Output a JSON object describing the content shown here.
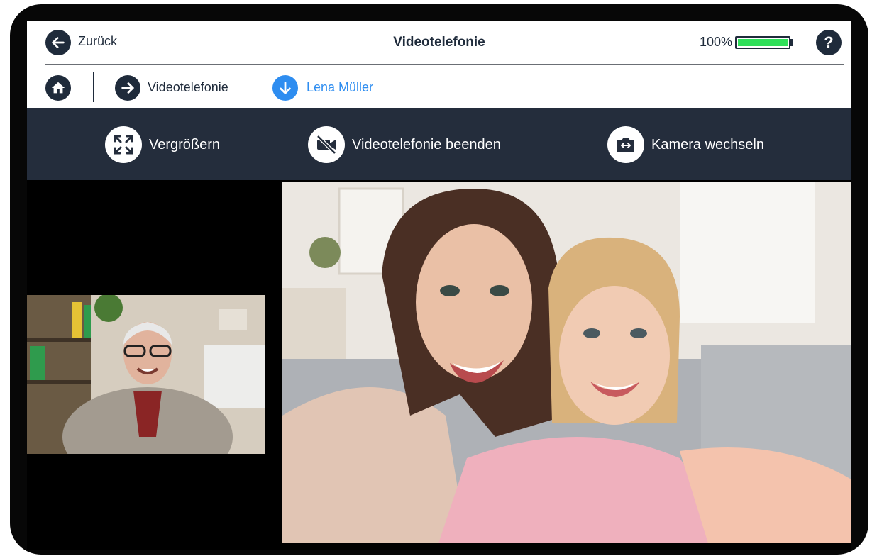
{
  "header": {
    "back_label": "Zurück",
    "title": "Videotelefonie",
    "battery_text": "100%",
    "battery_level": 1.0,
    "help_label": "?"
  },
  "breadcrumb": {
    "items": [
      {
        "label": "Videotelefonie",
        "icon": "arrow-right-icon"
      },
      {
        "label": "Lena Müller",
        "icon": "arrow-down-icon"
      }
    ]
  },
  "toolbar": {
    "zoom_label": "Vergrößern",
    "end_label": "Videotelefonie beenden",
    "camera_label": "Kamera wechseln"
  },
  "colors": {
    "navy": "#1f2b3b",
    "toolbar": "#242d3c",
    "accent_blue": "#2e8df0",
    "battery_green": "#2ee05a"
  }
}
